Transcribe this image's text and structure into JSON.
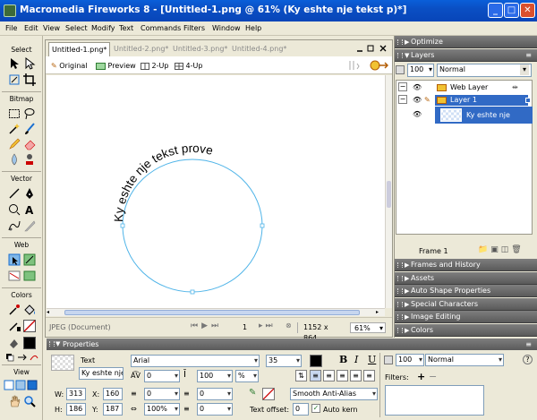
{
  "window": {
    "title": "Macromedia Fireworks 8 - [Untitled-1.png @  61% (Ky eshte nje tekst p)*]",
    "min_label": "_",
    "max_label": "□",
    "close_label": "✕"
  },
  "menu": [
    "File",
    "Edit",
    "View",
    "Select",
    "Modify",
    "Text",
    "Commands",
    "Filters",
    "Window",
    "Help"
  ],
  "tools": {
    "sections": [
      "Select",
      "Bitmap",
      "Vector",
      "Web",
      "Colors",
      "View"
    ]
  },
  "document": {
    "tabs": [
      "Untitled-1.png*",
      "Untitled-2.png*",
      "Untitled-3.png*",
      "Untitled-4.png*"
    ],
    "views": [
      "Original",
      "Preview",
      "2-Up",
      "4-Up"
    ],
    "canvas_text": "Ky eshte nje tekst prove",
    "status_format": "JPEG (Document)",
    "frame_number": "1",
    "dimensions": "1152 x 864",
    "zoom": "61%"
  },
  "panels": {
    "optimize": "Optimize",
    "layers": "Layers",
    "opacity": "100",
    "blend": "Normal",
    "web_layer": "Web Layer",
    "layer1": "Layer 1",
    "object": "Ky eshte nje tekst...",
    "frame": "Frame 1",
    "collapsed": [
      "Frames and History",
      "Assets",
      "Auto Shape Properties",
      "Special Characters",
      "Image Editing",
      "Colors"
    ]
  },
  "properties": {
    "header": "Properties",
    "type": "Text",
    "name": "Ky eshte nje",
    "font": "Arial",
    "size": "35",
    "kerning": "0",
    "leading": "100",
    "leading_unit": "%",
    "indent": "0",
    "space_before": "0",
    "space_after": "0",
    "horiz_scale": "100%",
    "baseline": "0",
    "bold": "B",
    "italic": "I",
    "underline": "U",
    "antialias": "Smooth Anti-Alias",
    "text_offset_label": "Text offset:",
    "text_offset": "0",
    "autokern": "Auto kern",
    "w_label": "W:",
    "w": "313",
    "h_label": "H:",
    "h": "186",
    "x_label": "X:",
    "x": "160",
    "y_label": "Y:",
    "y": "187",
    "opacity": "100",
    "blend": "Normal",
    "filters_label": "Filters:",
    "help": "?"
  },
  "colors": {
    "titlebar": "#0a4fc4",
    "selection": "#316ac5",
    "path": "#4fb4e8"
  }
}
